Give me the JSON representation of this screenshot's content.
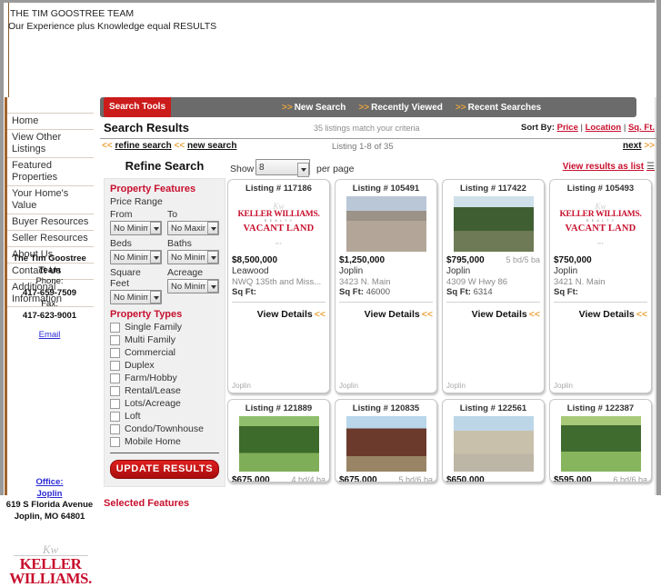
{
  "masthead": {
    "title": "THE TIM GOOSTREE TEAM",
    "tagline": "Our Experience plus Knowledge equal RESULTS"
  },
  "sidebar": {
    "nav": [
      {
        "label": "Home"
      },
      {
        "label": "View Other Listings"
      },
      {
        "label": "Featured Properties"
      },
      {
        "label": "Your Home's Value"
      },
      {
        "label": "Buyer Resources"
      },
      {
        "label": "Seller Resources"
      },
      {
        "label": "About Us"
      },
      {
        "label": "Contact Us"
      },
      {
        "label": "Additional Information"
      }
    ],
    "agent": {
      "name": "The Tim Goostree Team",
      "phone_label": "Phone:",
      "phone": "417-659-7509",
      "fax_label": "Fax:",
      "fax": "417-623-9001",
      "email_label": "Email"
    },
    "office": {
      "office_label": "Office:",
      "city_link": "Joplin",
      "street": "619 S Florida Avenue",
      "citystate": "Joplin, MO 64801"
    },
    "brand": {
      "mark": "Kw",
      "line1": "KELLER",
      "line2": "WILLIAMS."
    }
  },
  "toolbar": {
    "search_tools": "Search Tools",
    "links": [
      {
        "label": "New Search"
      },
      {
        "label": "Recently Viewed"
      },
      {
        "label": "Recent Searches"
      }
    ],
    "chevron": ">>"
  },
  "results_header": {
    "title": "Search Results",
    "count_text": "35 listings match your criteria",
    "sort_by_label": "Sort By:",
    "sort_options": [
      "Price",
      "Location",
      "Sq. Ft."
    ]
  },
  "nav_line": {
    "refine_search": "refine search",
    "new_search": "new search",
    "chevron_left": "<<",
    "listing_range": "Listing 1-8 of 35",
    "next": "next",
    "chevron_right": ">>"
  },
  "refine": {
    "title": "Refine Search",
    "property_features_head": "Property Features",
    "price_range_label": "Price Range",
    "from_label": "From",
    "to_label": "To",
    "price_from": "No Minimum",
    "price_to": "No Maximum",
    "beds_label": "Beds",
    "baths_label": "Baths",
    "beds_value": "No Minimum",
    "baths_value": "No Minimum",
    "sqft_label": "Square Feet",
    "acreage_label": "Acreage",
    "sqft_value": "No Minimum",
    "acreage_value": "No Minimum",
    "property_types_head": "Property Types",
    "property_types": [
      "Single Family",
      "Multi Family",
      "Commercial",
      "Duplex",
      "Farm/Hobby",
      "Rental/Lease",
      "Lots/Acreage",
      "Loft",
      "Condo/Townhouse",
      "Mobile Home"
    ],
    "update_button": "UPDATE RESULTS",
    "selected_features_head": "Selected Features"
  },
  "results_controls": {
    "show_label": "Show",
    "show_value": "8",
    "per_page_label": "per page",
    "view_as_list": "View results as list",
    "list_glyph": "☰"
  },
  "listing_labels": {
    "listing_prefix": "Listing #",
    "sqft_label": "Sq Ft:",
    "view_details": "View Details",
    "view_chevron": "<<",
    "footer_city": "Joplin"
  },
  "listings": [
    {
      "number": "117186",
      "price": "$8,500,000",
      "beds_baths": "",
      "city": "Leawood",
      "address": "NWQ 135th and Miss...",
      "sqft": "",
      "photo": "vacant-land",
      "photo_class": ""
    },
    {
      "number": "105491",
      "price": "$1,250,000",
      "beds_baths": "",
      "city": "Joplin",
      "address": "3423 N. Main",
      "sqft": "46000",
      "photo": "photo",
      "photo_class": "ph1"
    },
    {
      "number": "117422",
      "price": "$795,000",
      "beds_baths": "5 bd/5 ba",
      "city": "Joplin",
      "address": "4309 W Hwy 86",
      "sqft": "6314",
      "photo": "photo",
      "photo_class": "ph2"
    },
    {
      "number": "105493",
      "price": "$750,000",
      "beds_baths": "",
      "city": "Joplin",
      "address": "3421 N. Main",
      "sqft": "",
      "photo": "vacant-land",
      "photo_class": ""
    }
  ],
  "listings_row2": [
    {
      "number": "121889",
      "price": "$675,000",
      "beds_baths": "4 bd/4 ba",
      "photo_class": "ph3"
    },
    {
      "number": "120835",
      "price": "$675,000",
      "beds_baths": "5 bd/6 ba",
      "photo_class": "ph4"
    },
    {
      "number": "122561",
      "price": "$650,000",
      "beds_baths": "",
      "photo_class": "ph5"
    },
    {
      "number": "122387",
      "price": "$595,000",
      "beds_baths": "6 bd/6 ba",
      "photo_class": "ph6"
    }
  ],
  "colors": {
    "brand_red": "#c8102e",
    "button_red": "#cc1b1b",
    "toolbar_gray": "#6b6b6b",
    "accent_gold": "#e8a33d",
    "link_blue": "#2b2bd4"
  }
}
